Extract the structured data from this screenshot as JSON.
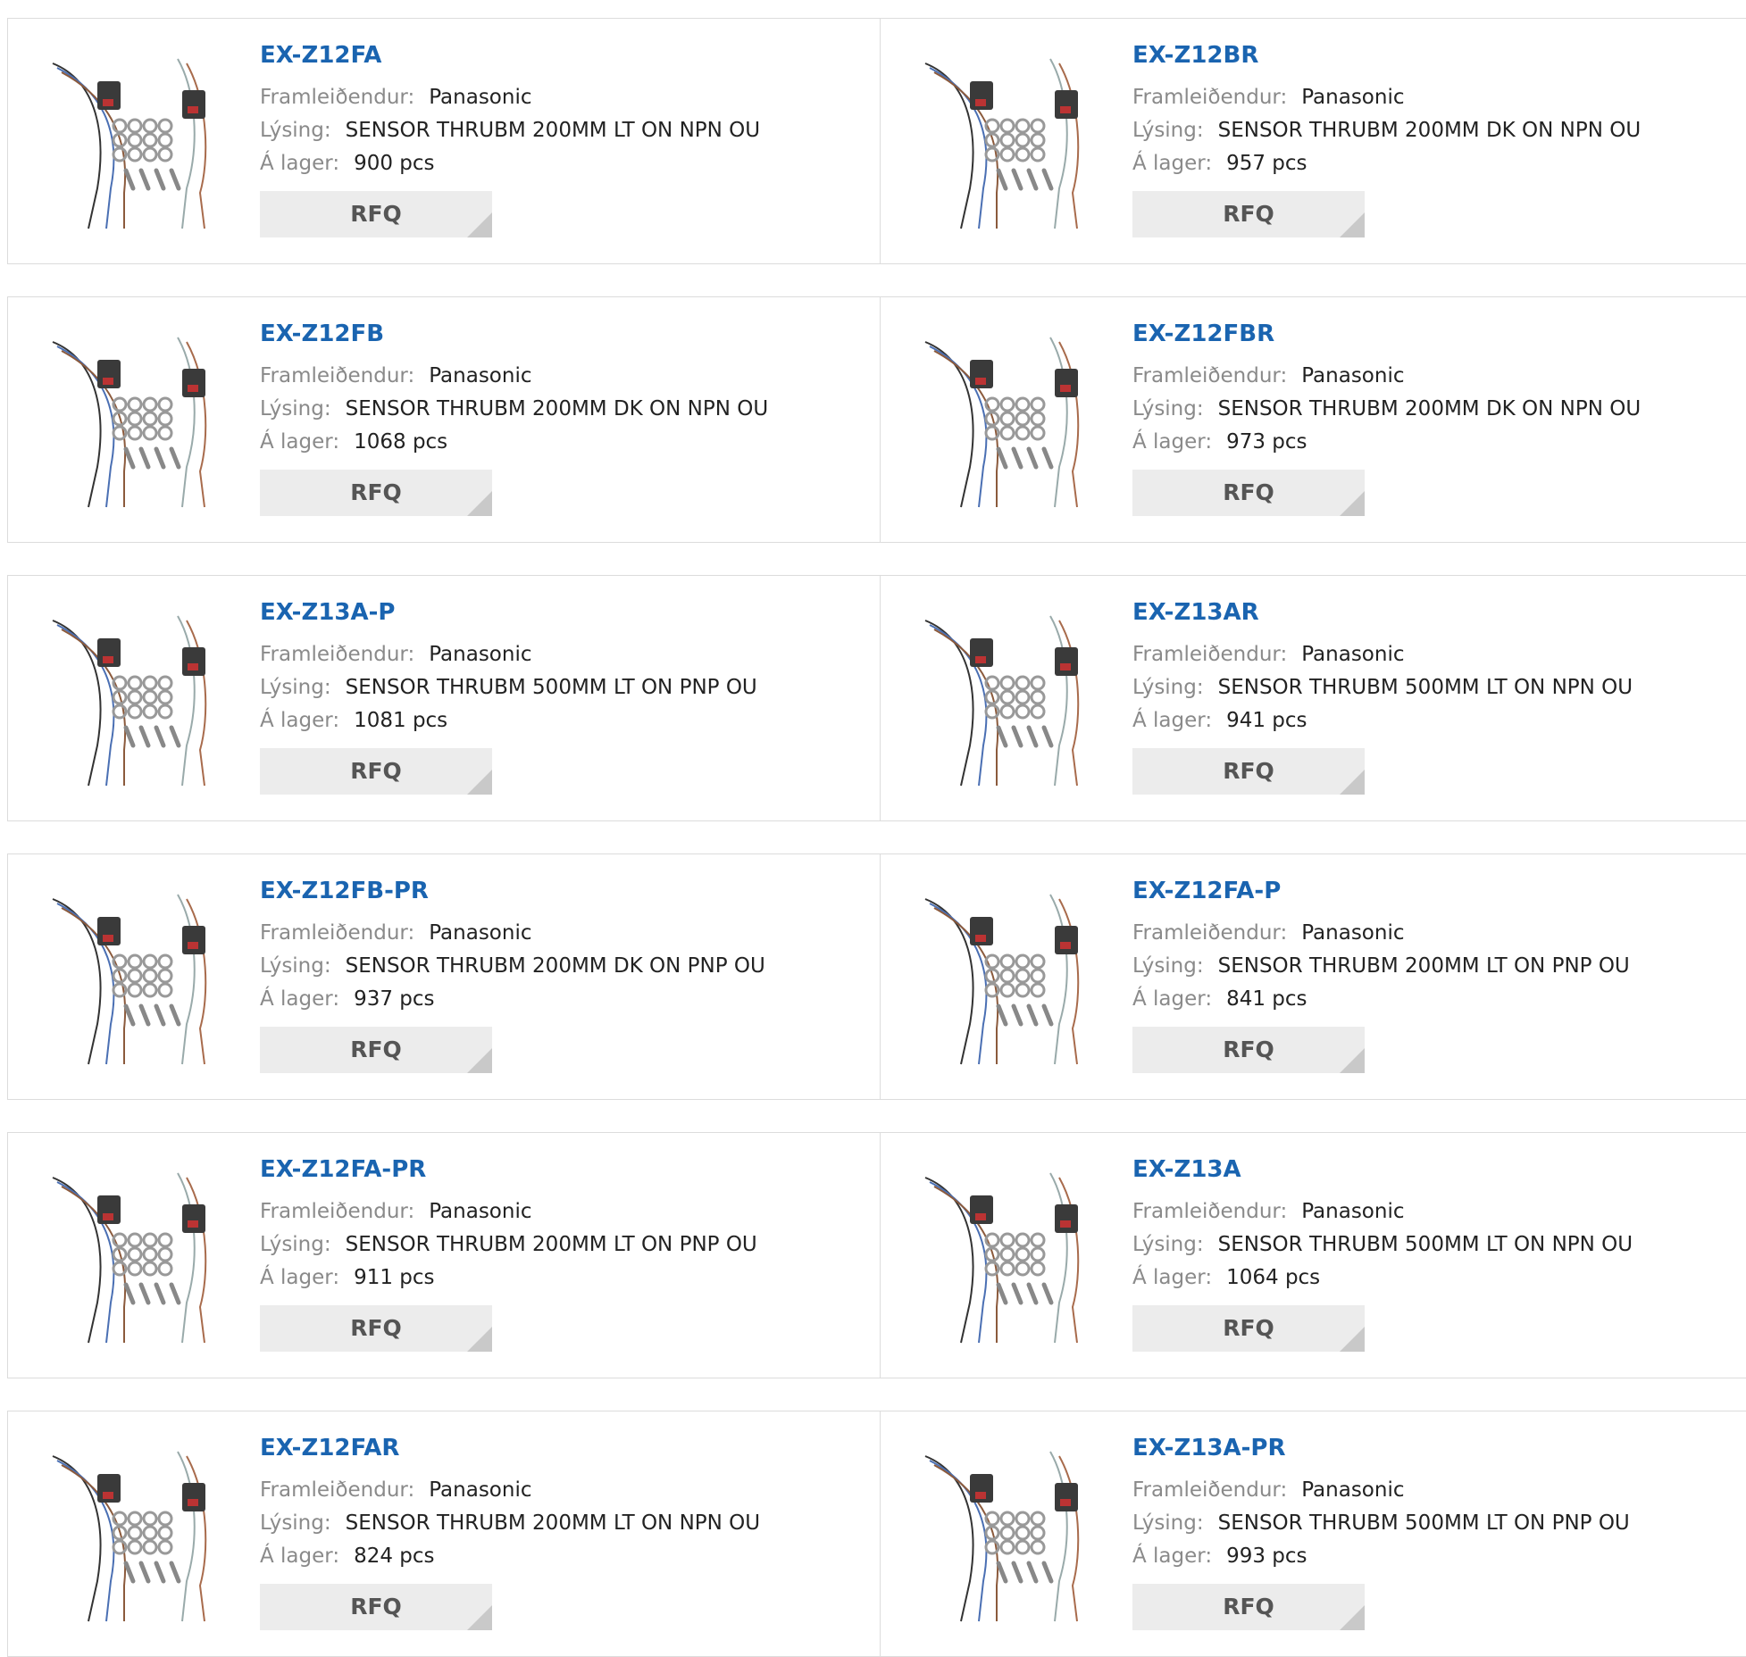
{
  "labels": {
    "manufacturer": "Framleiðendur:",
    "description": "Lýsing:",
    "stock": "Á lager:",
    "rfq": "RFQ"
  },
  "products": [
    {
      "part": "EX-Z12FA",
      "manufacturer": "Panasonic",
      "description": "SENSOR THRUBM 200MM LT ON NPN OU",
      "stock": "900 pcs",
      "image_icon": "sensor-kit-icon"
    },
    {
      "part": "EX-Z12BR",
      "manufacturer": "Panasonic",
      "description": "SENSOR THRUBM 200MM DK ON NPN OU",
      "stock": "957 pcs",
      "image_icon": "sensor-kit-icon"
    },
    {
      "part": "EX-Z12FB",
      "manufacturer": "Panasonic",
      "description": "SENSOR THRUBM 200MM DK ON NPN OU",
      "stock": "1068 pcs",
      "image_icon": "sensor-kit-icon"
    },
    {
      "part": "EX-Z12FBR",
      "manufacturer": "Panasonic",
      "description": "SENSOR THRUBM 200MM DK ON NPN OU",
      "stock": "973 pcs",
      "image_icon": "sensor-kit-icon"
    },
    {
      "part": "EX-Z13A-P",
      "manufacturer": "Panasonic",
      "description": "SENSOR THRUBM 500MM LT ON PNP OU",
      "stock": "1081 pcs",
      "image_icon": "sensor-kit-icon"
    },
    {
      "part": "EX-Z13AR",
      "manufacturer": "Panasonic",
      "description": "SENSOR THRUBM 500MM LT ON NPN OU",
      "stock": "941 pcs",
      "image_icon": "sensor-kit-icon"
    },
    {
      "part": "EX-Z12FB-PR",
      "manufacturer": "Panasonic",
      "description": "SENSOR THRUBM 200MM DK ON PNP OU",
      "stock": "937 pcs",
      "image_icon": "sensor-kit-icon"
    },
    {
      "part": "EX-Z12FA-P",
      "manufacturer": "Panasonic",
      "description": "SENSOR THRUBM 200MM LT ON PNP OU",
      "stock": "841 pcs",
      "image_icon": "sensor-kit-icon"
    },
    {
      "part": "EX-Z12FA-PR",
      "manufacturer": "Panasonic",
      "description": "SENSOR THRUBM 200MM LT ON PNP OU",
      "stock": "911 pcs",
      "image_icon": "sensor-kit-icon"
    },
    {
      "part": "EX-Z13A",
      "manufacturer": "Panasonic",
      "description": "SENSOR THRUBM 500MM LT ON NPN OU",
      "stock": "1064 pcs",
      "image_icon": "sensor-kit-icon"
    },
    {
      "part": "EX-Z12FAR",
      "manufacturer": "Panasonic",
      "description": "SENSOR THRUBM 200MM LT ON NPN OU",
      "stock": "824 pcs",
      "image_icon": "sensor-kit-icon"
    },
    {
      "part": "EX-Z13A-PR",
      "manufacturer": "Panasonic",
      "description": "SENSOR THRUBM 500MM LT ON PNP OU",
      "stock": "993 pcs",
      "image_icon": "sensor-kit-icon"
    }
  ],
  "colors": {
    "title": "#1a64b0",
    "label": "#8a8a8a",
    "value": "#222222",
    "button_bg": "#ececec",
    "border": "#dcdcdc"
  }
}
